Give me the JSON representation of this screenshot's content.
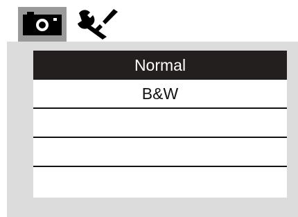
{
  "tabs": [
    {
      "icon": "camera-icon",
      "active": true
    },
    {
      "icon": "tools-icon",
      "active": false
    }
  ],
  "menu": {
    "items": [
      {
        "label": "Normal",
        "selected": true
      },
      {
        "label": "B&W",
        "selected": false
      },
      {
        "label": "",
        "selected": false
      },
      {
        "label": "",
        "selected": false
      },
      {
        "label": "",
        "selected": false
      }
    ]
  },
  "colors": {
    "active_tab_bg": "#9a9a9a",
    "panel_bg": "#dcdcdc",
    "selected_bg": "#231f1f",
    "selected_text": "#ffffff",
    "text": "#111111"
  }
}
